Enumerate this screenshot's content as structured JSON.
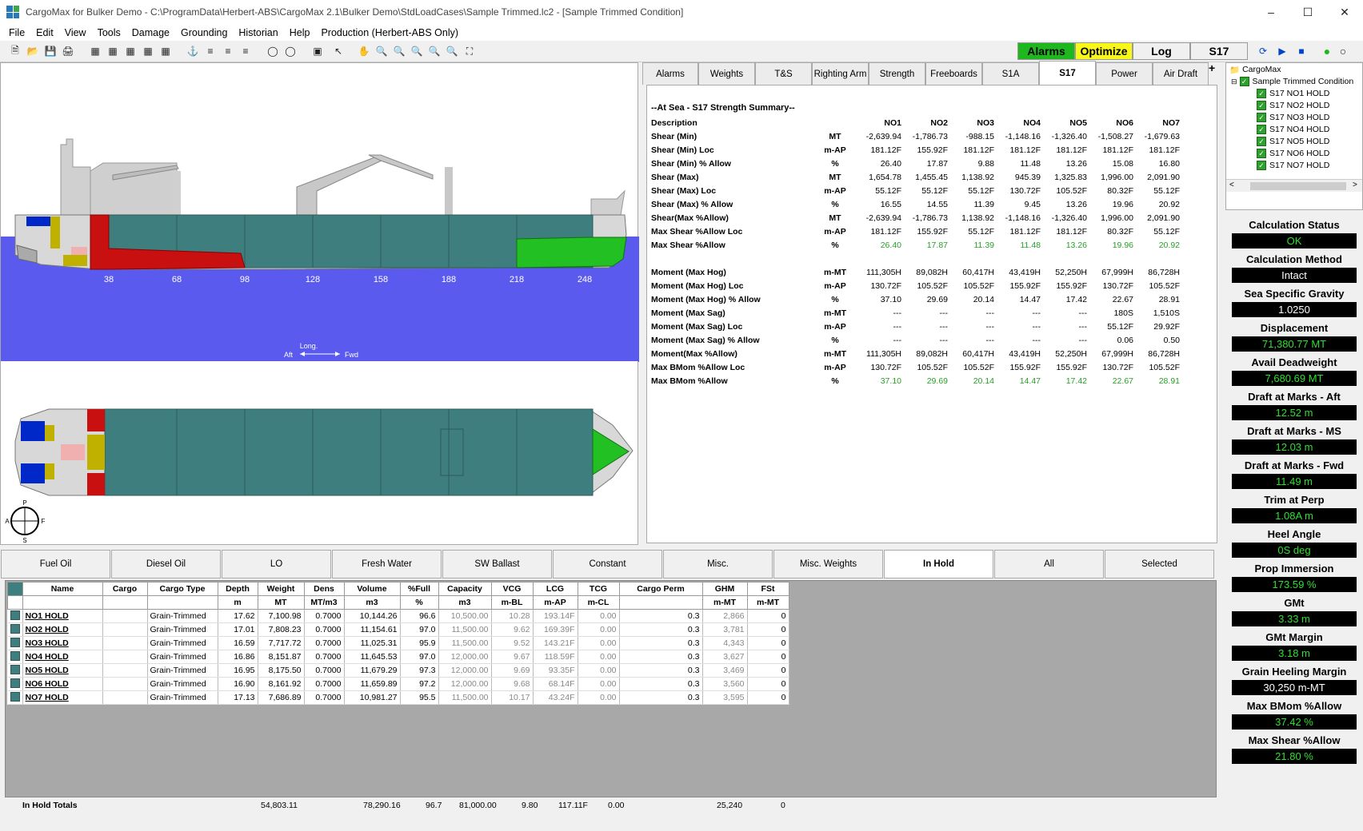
{
  "window": {
    "title": "CargoMax for Bulker Demo - C:\\ProgramData\\Herbert-ABS\\CargoMax 2.1\\Bulker Demo\\StdLoadCases\\Sample Trimmed.lc2 - [Sample Trimmed Condition]"
  },
  "menu": [
    "File",
    "Edit",
    "View",
    "Tools",
    "Damage",
    "Grounding",
    "Historian",
    "Help",
    "Production (Herbert-ABS Only)"
  ],
  "toolbar": {
    "alarms": "Alarms",
    "optimize": "Optimize",
    "log": "Log",
    "s17": "S17"
  },
  "profile": {
    "frames": [
      "38",
      "68",
      "98",
      "128",
      "158",
      "188",
      "218",
      "248"
    ],
    "long_label": "Long.",
    "aft": "Aft",
    "fwd": "Fwd"
  },
  "compass": {
    "p": "P",
    "a": "A",
    "f": "F",
    "s": "S"
  },
  "right_tabs": [
    "Alarms",
    "Weights",
    "T&S",
    "Righting Arm",
    "Strength",
    "Freeboards",
    "S1A",
    "S17",
    "Power",
    "Air Draft"
  ],
  "summary": {
    "title": "--At Sea - S17 Strength Summary--",
    "columns": [
      "Description",
      "",
      "NO1",
      "NO2",
      "NO3",
      "NO4",
      "NO5",
      "NO6",
      "NO7"
    ],
    "rows": [
      {
        "d": "Shear (Min)",
        "u": "MT",
        "v": [
          "-2,639.94",
          "-1,786.73",
          "-988.15",
          "-1,148.16",
          "-1,326.40",
          "-1,508.27",
          "-1,679.63"
        ],
        "g": false
      },
      {
        "d": "Shear (Min) Loc",
        "u": "m-AP",
        "v": [
          "181.12F",
          "155.92F",
          "181.12F",
          "181.12F",
          "181.12F",
          "181.12F",
          "181.12F"
        ],
        "g": false
      },
      {
        "d": "Shear (Min) % Allow",
        "u": "%",
        "v": [
          "26.40",
          "17.87",
          "9.88",
          "11.48",
          "13.26",
          "15.08",
          "16.80"
        ],
        "g": false
      },
      {
        "d": "Shear (Max)",
        "u": "MT",
        "v": [
          "1,654.78",
          "1,455.45",
          "1,138.92",
          "945.39",
          "1,325.83",
          "1,996.00",
          "2,091.90"
        ],
        "g": false
      },
      {
        "d": "Shear (Max) Loc",
        "u": "m-AP",
        "v": [
          "55.12F",
          "55.12F",
          "55.12F",
          "130.72F",
          "105.52F",
          "80.32F",
          "55.12F"
        ],
        "g": false
      },
      {
        "d": "Shear (Max) % Allow",
        "u": "%",
        "v": [
          "16.55",
          "14.55",
          "11.39",
          "9.45",
          "13.26",
          "19.96",
          "20.92"
        ],
        "g": false
      },
      {
        "d": "Shear(Max %Allow)",
        "u": "MT",
        "v": [
          "-2,639.94",
          "-1,786.73",
          "1,138.92",
          "-1,148.16",
          "-1,326.40",
          "1,996.00",
          "2,091.90"
        ],
        "g": false
      },
      {
        "d": "Max Shear %Allow Loc",
        "u": "m-AP",
        "v": [
          "181.12F",
          "155.92F",
          "55.12F",
          "181.12F",
          "181.12F",
          "80.32F",
          "55.12F"
        ],
        "g": false
      },
      {
        "d": "Max Shear %Allow",
        "u": "%",
        "v": [
          "26.40",
          "17.87",
          "11.39",
          "11.48",
          "13.26",
          "19.96",
          "20.92"
        ],
        "g": true
      },
      {
        "d": "",
        "u": "",
        "v": [
          "",
          "",
          "",
          "",
          "",
          "",
          ""
        ],
        "g": false
      },
      {
        "d": "Moment (Max Hog)",
        "u": "m-MT",
        "v": [
          "111,305H",
          "89,082H",
          "60,417H",
          "43,419H",
          "52,250H",
          "67,999H",
          "86,728H"
        ],
        "g": false
      },
      {
        "d": "Moment (Max Hog) Loc",
        "u": "m-AP",
        "v": [
          "130.72F",
          "105.52F",
          "105.52F",
          "155.92F",
          "155.92F",
          "130.72F",
          "105.52F"
        ],
        "g": false
      },
      {
        "d": "Moment (Max Hog) % Allow",
        "u": "%",
        "v": [
          "37.10",
          "29.69",
          "20.14",
          "14.47",
          "17.42",
          "22.67",
          "28.91"
        ],
        "g": false
      },
      {
        "d": "Moment (Max Sag)",
        "u": "m-MT",
        "v": [
          "---",
          "---",
          "---",
          "---",
          "---",
          "180S",
          "1,510S"
        ],
        "g": false
      },
      {
        "d": "Moment (Max Sag) Loc",
        "u": "m-AP",
        "v": [
          "---",
          "---",
          "---",
          "---",
          "---",
          "55.12F",
          "29.92F"
        ],
        "g": false
      },
      {
        "d": "Moment (Max Sag) % Allow",
        "u": "%",
        "v": [
          "---",
          "---",
          "---",
          "---",
          "---",
          "0.06",
          "0.50"
        ],
        "g": false
      },
      {
        "d": "Moment(Max %Allow)",
        "u": "m-MT",
        "v": [
          "111,305H",
          "89,082H",
          "60,417H",
          "43,419H",
          "52,250H",
          "67,999H",
          "86,728H"
        ],
        "g": false
      },
      {
        "d": "Max BMom %Allow Loc",
        "u": "m-AP",
        "v": [
          "130.72F",
          "105.52F",
          "105.52F",
          "155.92F",
          "155.92F",
          "130.72F",
          "105.52F"
        ],
        "g": false
      },
      {
        "d": "Max BMom %Allow",
        "u": "%",
        "v": [
          "37.10",
          "29.69",
          "20.14",
          "14.47",
          "17.42",
          "22.67",
          "28.91"
        ],
        "g": true
      }
    ]
  },
  "tree": {
    "root": "CargoMax",
    "condition": "Sample Trimmed Condition",
    "items": [
      "S17 NO1 HOLD",
      "S17 NO2 HOLD",
      "S17 NO3 HOLD",
      "S17 NO4 HOLD",
      "S17 NO5 HOLD",
      "S17 NO6 HOLD",
      "S17 NO7 HOLD"
    ]
  },
  "status": [
    {
      "label": "Calculation Status",
      "value": "OK",
      "white": false
    },
    {
      "label": "Calculation Method",
      "value": "Intact",
      "white": true
    },
    {
      "label": "Sea Specific Gravity",
      "value": "1.0250",
      "white": true
    },
    {
      "label": "Displacement",
      "value": "71,380.77 MT",
      "white": false
    },
    {
      "label": "Avail Deadweight",
      "value": "7,680.69 MT",
      "white": false
    },
    {
      "label": "Draft at Marks - Aft",
      "value": "12.52 m",
      "white": false
    },
    {
      "label": "Draft at Marks - MS",
      "value": "12.03 m",
      "white": false
    },
    {
      "label": "Draft at Marks - Fwd",
      "value": "11.49 m",
      "white": false
    },
    {
      "label": "Trim at Perp",
      "value": "1.08A m",
      "white": false
    },
    {
      "label": "Heel Angle",
      "value": "0S deg",
      "white": false
    },
    {
      "label": "Prop Immersion",
      "value": "173.59 %",
      "white": false
    },
    {
      "label": "GMt",
      "value": "3.33 m",
      "white": false
    },
    {
      "label": "GMt Margin",
      "value": "3.18 m",
      "white": false
    },
    {
      "label": "Grain Heeling Margin",
      "value": "30,250 m-MT",
      "white": true
    },
    {
      "label": "Max BMom %Allow",
      "value": "37.42 %",
      "white": false
    },
    {
      "label": "Max Shear %Allow",
      "value": "21.80 %",
      "white": false
    }
  ],
  "bottom_tabs": [
    "Fuel Oil",
    "Diesel Oil",
    "LO",
    "Fresh Water",
    "SW Ballast",
    "Constant",
    "Misc.",
    "Misc. Weights",
    "In Hold",
    "All",
    "Selected"
  ],
  "holds": {
    "headers": [
      "Name",
      "Cargo",
      "Cargo Type",
      "Depth",
      "Weight",
      "Dens",
      "Volume",
      "%Full",
      "Capacity",
      "VCG",
      "LCG",
      "TCG",
      "Cargo Perm",
      "GHM",
      "FSt"
    ],
    "units": [
      "",
      "",
      "",
      "m",
      "MT",
      "MT/m3",
      "m3",
      "%",
      "m3",
      "m-BL",
      "m-AP",
      "m-CL",
      "",
      "m-MT",
      "m-MT"
    ],
    "rows": [
      [
        "NO1 HOLD",
        "",
        "Grain-Trimmed",
        "17.62",
        "7,100.98",
        "0.7000",
        "10,144.26",
        "96.6",
        "10,500.00",
        "10.28",
        "193.14F",
        "0.00",
        "0.3",
        "2,866",
        "0"
      ],
      [
        "NO2 HOLD",
        "",
        "Grain-Trimmed",
        "17.01",
        "7,808.23",
        "0.7000",
        "11,154.61",
        "97.0",
        "11,500.00",
        "9.62",
        "169.39F",
        "0.00",
        "0.3",
        "3,781",
        "0"
      ],
      [
        "NO3 HOLD",
        "",
        "Grain-Trimmed",
        "16.59",
        "7,717.72",
        "0.7000",
        "11,025.31",
        "95.9",
        "11,500.00",
        "9.52",
        "143.21F",
        "0.00",
        "0.3",
        "4,343",
        "0"
      ],
      [
        "NO4 HOLD",
        "",
        "Grain-Trimmed",
        "16.86",
        "8,151.87",
        "0.7000",
        "11,645.53",
        "97.0",
        "12,000.00",
        "9.67",
        "118.59F",
        "0.00",
        "0.3",
        "3,627",
        "0"
      ],
      [
        "NO5 HOLD",
        "",
        "Grain-Trimmed",
        "16.95",
        "8,175.50",
        "0.7000",
        "11,679.29",
        "97.3",
        "12,000.00",
        "9.69",
        "93.35F",
        "0.00",
        "0.3",
        "3,469",
        "0"
      ],
      [
        "NO6 HOLD",
        "",
        "Grain-Trimmed",
        "16.90",
        "8,161.92",
        "0.7000",
        "11,659.89",
        "97.2",
        "12,000.00",
        "9.68",
        "68.14F",
        "0.00",
        "0.3",
        "3,560",
        "0"
      ],
      [
        "NO7 HOLD",
        "",
        "Grain-Trimmed",
        "17.13",
        "7,686.89",
        "0.7000",
        "10,981.27",
        "95.5",
        "11,500.00",
        "10.17",
        "43.24F",
        "0.00",
        "0.3",
        "3,595",
        "0"
      ]
    ],
    "totals": {
      "label": "In Hold Totals",
      "weight": "54,803.11",
      "volume": "78,290.16",
      "full": "96.7",
      "capacity": "81,000.00",
      "vcg": "9.80",
      "lcg": "117.11F",
      "tcg": "0.00",
      "ghm": "25,240",
      "fst": "0"
    }
  },
  "colors": {
    "hold": "#3e7e7e",
    "sea": "#5a5aee",
    "ballast_red": "#c81010",
    "green_tank": "#22c022",
    "status_green": "#2ee02e"
  }
}
